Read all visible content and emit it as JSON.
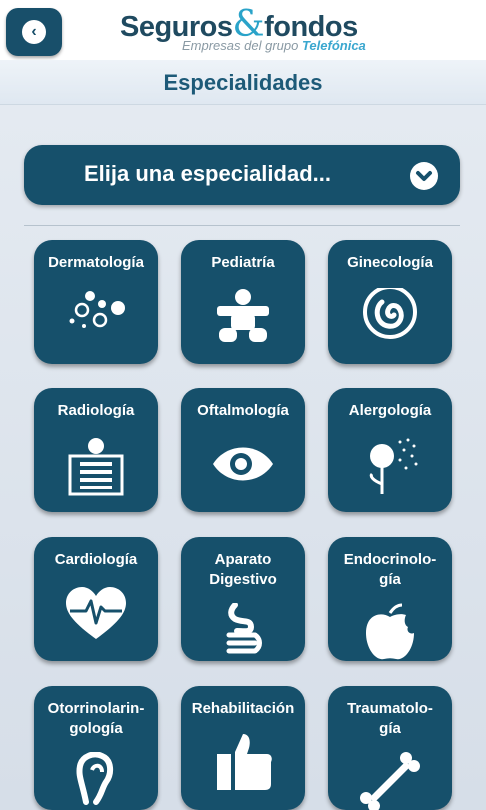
{
  "header": {
    "back_label": "back",
    "logo_part1": "Seguros",
    "logo_amp": "&",
    "logo_part2": "fondos",
    "logo_sub": "Empresas del grupo",
    "logo_brand": "Telefónica"
  },
  "page_title": "Especialidades",
  "dropdown": {
    "label": "Elija una especialidad...",
    "icon": "chevron-down-icon"
  },
  "colors": {
    "tile": "#16506b",
    "title": "#1d5a78",
    "background": "#dfe6ee"
  },
  "specialties": [
    {
      "label": "Dermatología",
      "icon": "skin-cells-icon"
    },
    {
      "label": "Pediatría",
      "icon": "baby-icon"
    },
    {
      "label": "Ginecología",
      "icon": "fetus-icon"
    },
    {
      "label": "Radiología",
      "icon": "xray-icon"
    },
    {
      "label": "Oftalmología",
      "icon": "eye-icon"
    },
    {
      "label": "Alergología",
      "icon": "dandelion-icon"
    },
    {
      "label": "Cardiología",
      "icon": "heart-icon"
    },
    {
      "label": "Aparato\nDigestivo",
      "icon": "digestive-icon"
    },
    {
      "label": "Endocrinolo-\ngía",
      "icon": "apple-icon"
    },
    {
      "label": "Otorrinolarin-\ngología",
      "icon": "ear-icon"
    },
    {
      "label": "Rehabilitación",
      "icon": "thumbs-up-icon"
    },
    {
      "label": "Traumatolo-\ngía",
      "icon": "bone-icon"
    }
  ]
}
